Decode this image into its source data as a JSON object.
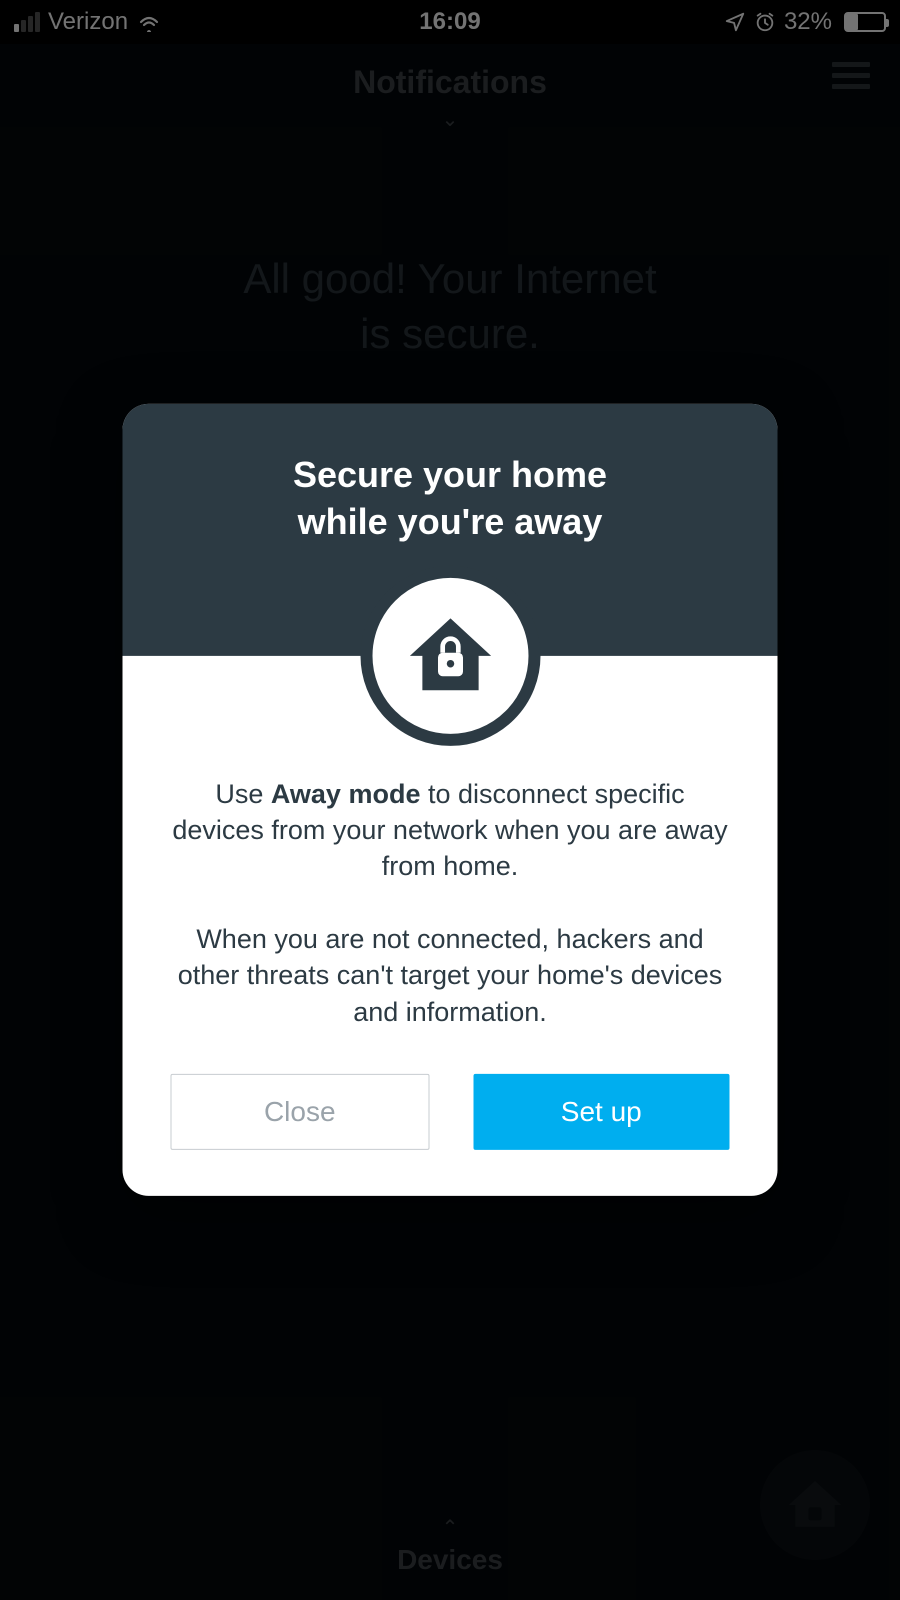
{
  "status": {
    "carrier": "Verizon",
    "time": "16:09",
    "battery_pct": "32%",
    "battery_level": 32
  },
  "background": {
    "header_title": "Notifications",
    "hero_line1": "All good! Your Internet",
    "hero_line2": "is secure.",
    "bottom_label": "Devices"
  },
  "modal": {
    "title_line1": "Secure your home",
    "title_line2": "while you're away",
    "body_p1_pre": "Use ",
    "body_p1_bold": "Away mode",
    "body_p1_post": " to disconnect specific devices from your network when you are away from home.",
    "body_p2": "When you are not connected, hackers and other threats can't target your home's devices and information.",
    "close_label": "Close",
    "setup_label": "Set up"
  },
  "colors": {
    "modal_header": "#2c3a43",
    "primary": "#00aeef"
  }
}
